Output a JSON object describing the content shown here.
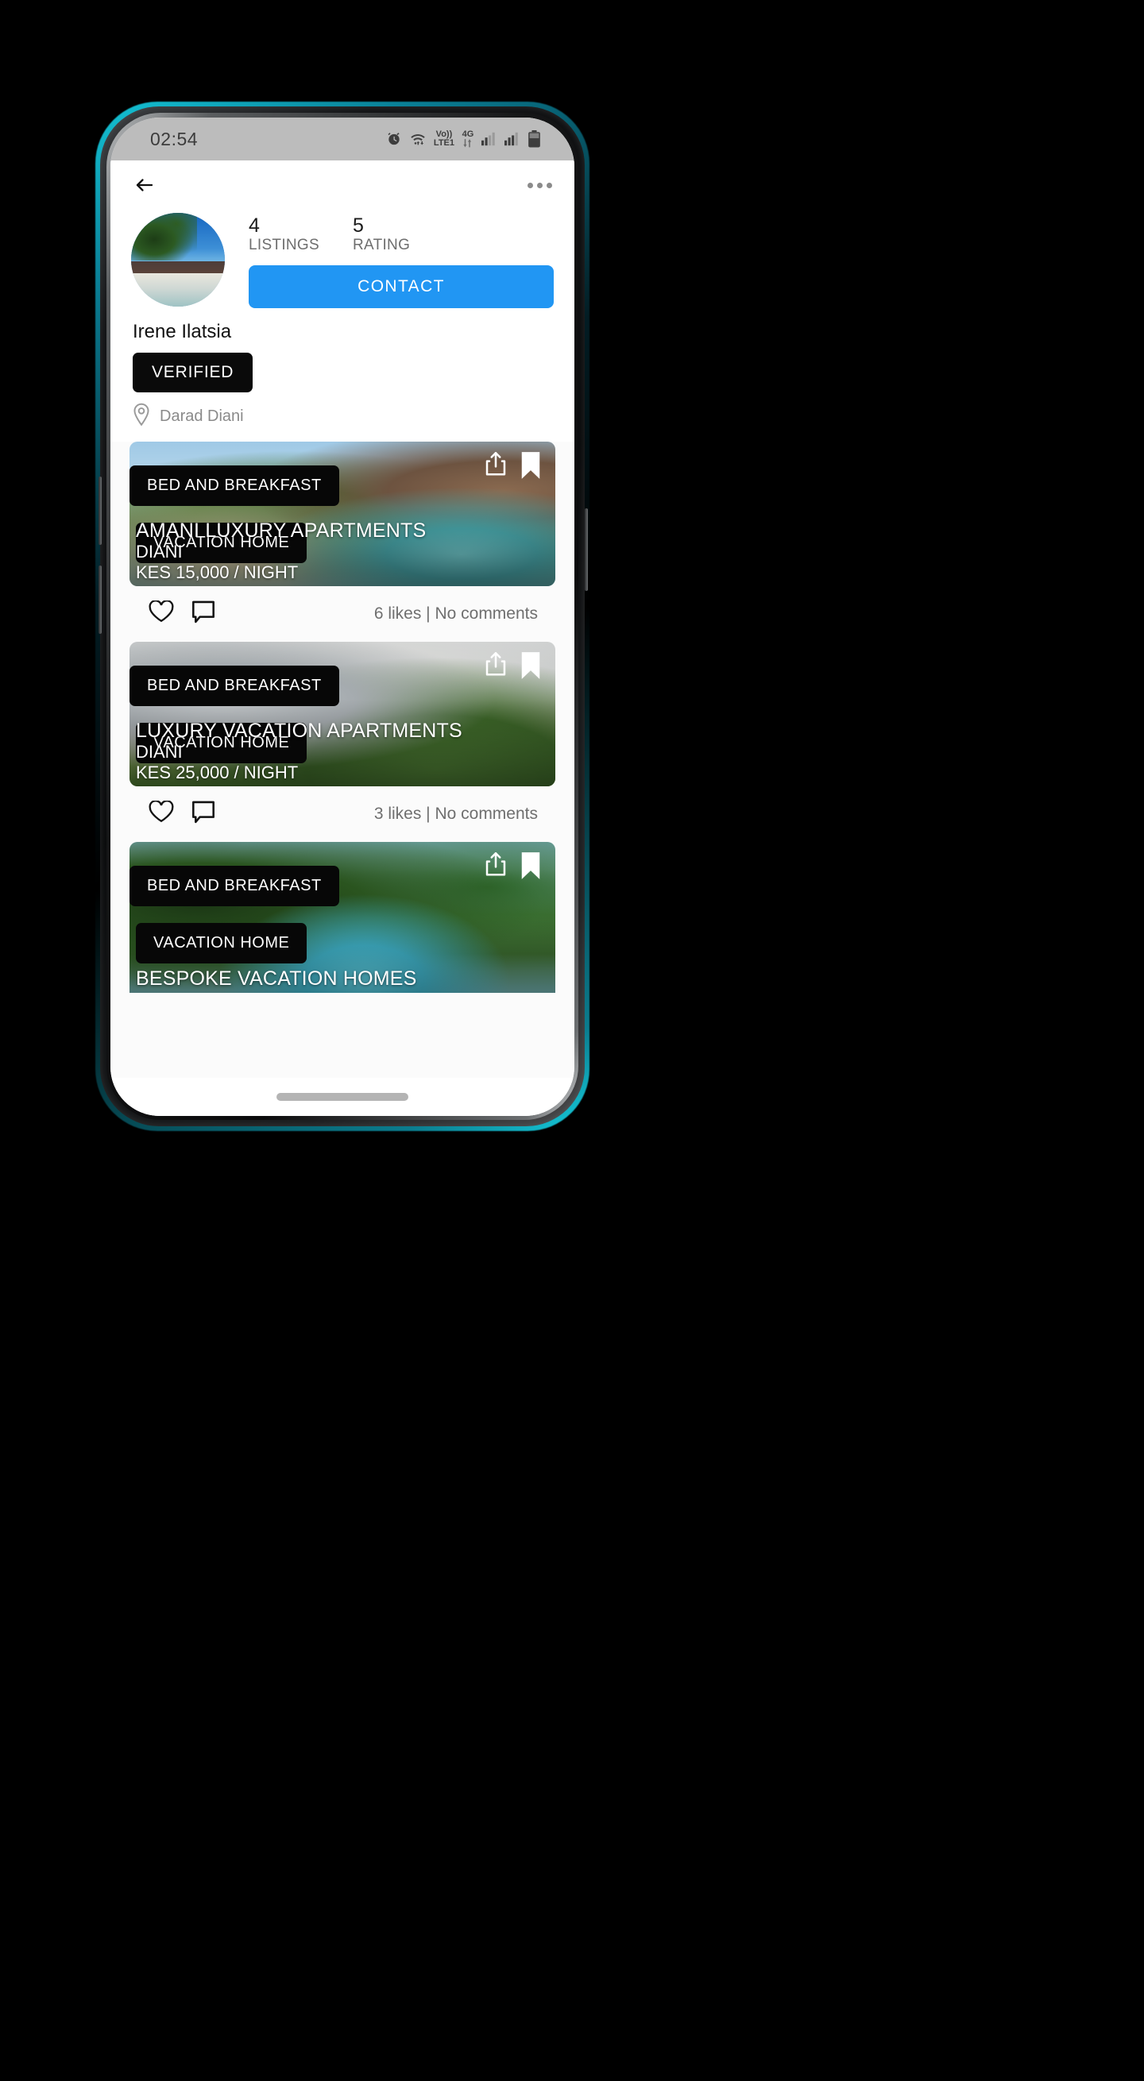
{
  "status_bar": {
    "time": "02:54",
    "icons": [
      "alarm-icon",
      "wifi-icon",
      "volte-icon",
      "fourg-icon",
      "signal-sim1-icon",
      "signal-sim2-icon",
      "battery-icon"
    ],
    "volte_label_top": "Vo))",
    "volte_label_bottom": "LTE1",
    "network_label": "4G"
  },
  "topbar": {
    "back_label": "back-arrow",
    "overflow_label": "more-options"
  },
  "profile": {
    "name": "Irene Ilatsia",
    "badge": "VERIFIED",
    "location": "Darad Diani",
    "contact_label": "CONTACT",
    "stats": [
      {
        "value": "4",
        "label": "LISTINGS"
      },
      {
        "value": "5",
        "label": "RATING"
      }
    ]
  },
  "theme": {
    "accent_blue": "#2196F3",
    "badge_black": "#0a0a0a",
    "status_bar_gray": "#bcbcbc",
    "app_bg": "#fbfbfb",
    "muted_text": "#6f6f6f"
  },
  "listings": [
    {
      "tag_primary": "BED AND BREAKFAST",
      "tag_secondary": "VACATION HOME",
      "title": "AMANI LUXURY APARTMENTS",
      "location": "DIANI",
      "price": "KES 15,000 / NIGHT",
      "engagement": "6 likes | No comments"
    },
    {
      "tag_primary": "BED AND BREAKFAST",
      "tag_secondary": "VACATION HOME",
      "title": "LUXURY VACATION APARTMENTS",
      "location": "DIANI",
      "price": "KES 25,000 / NIGHT",
      "engagement": "3 likes | No comments"
    },
    {
      "tag_primary": "BED AND BREAKFAST",
      "tag_secondary": "VACATION HOME",
      "title": "BESPOKE VACATION HOMES",
      "location": "",
      "price": "",
      "engagement": ""
    }
  ]
}
